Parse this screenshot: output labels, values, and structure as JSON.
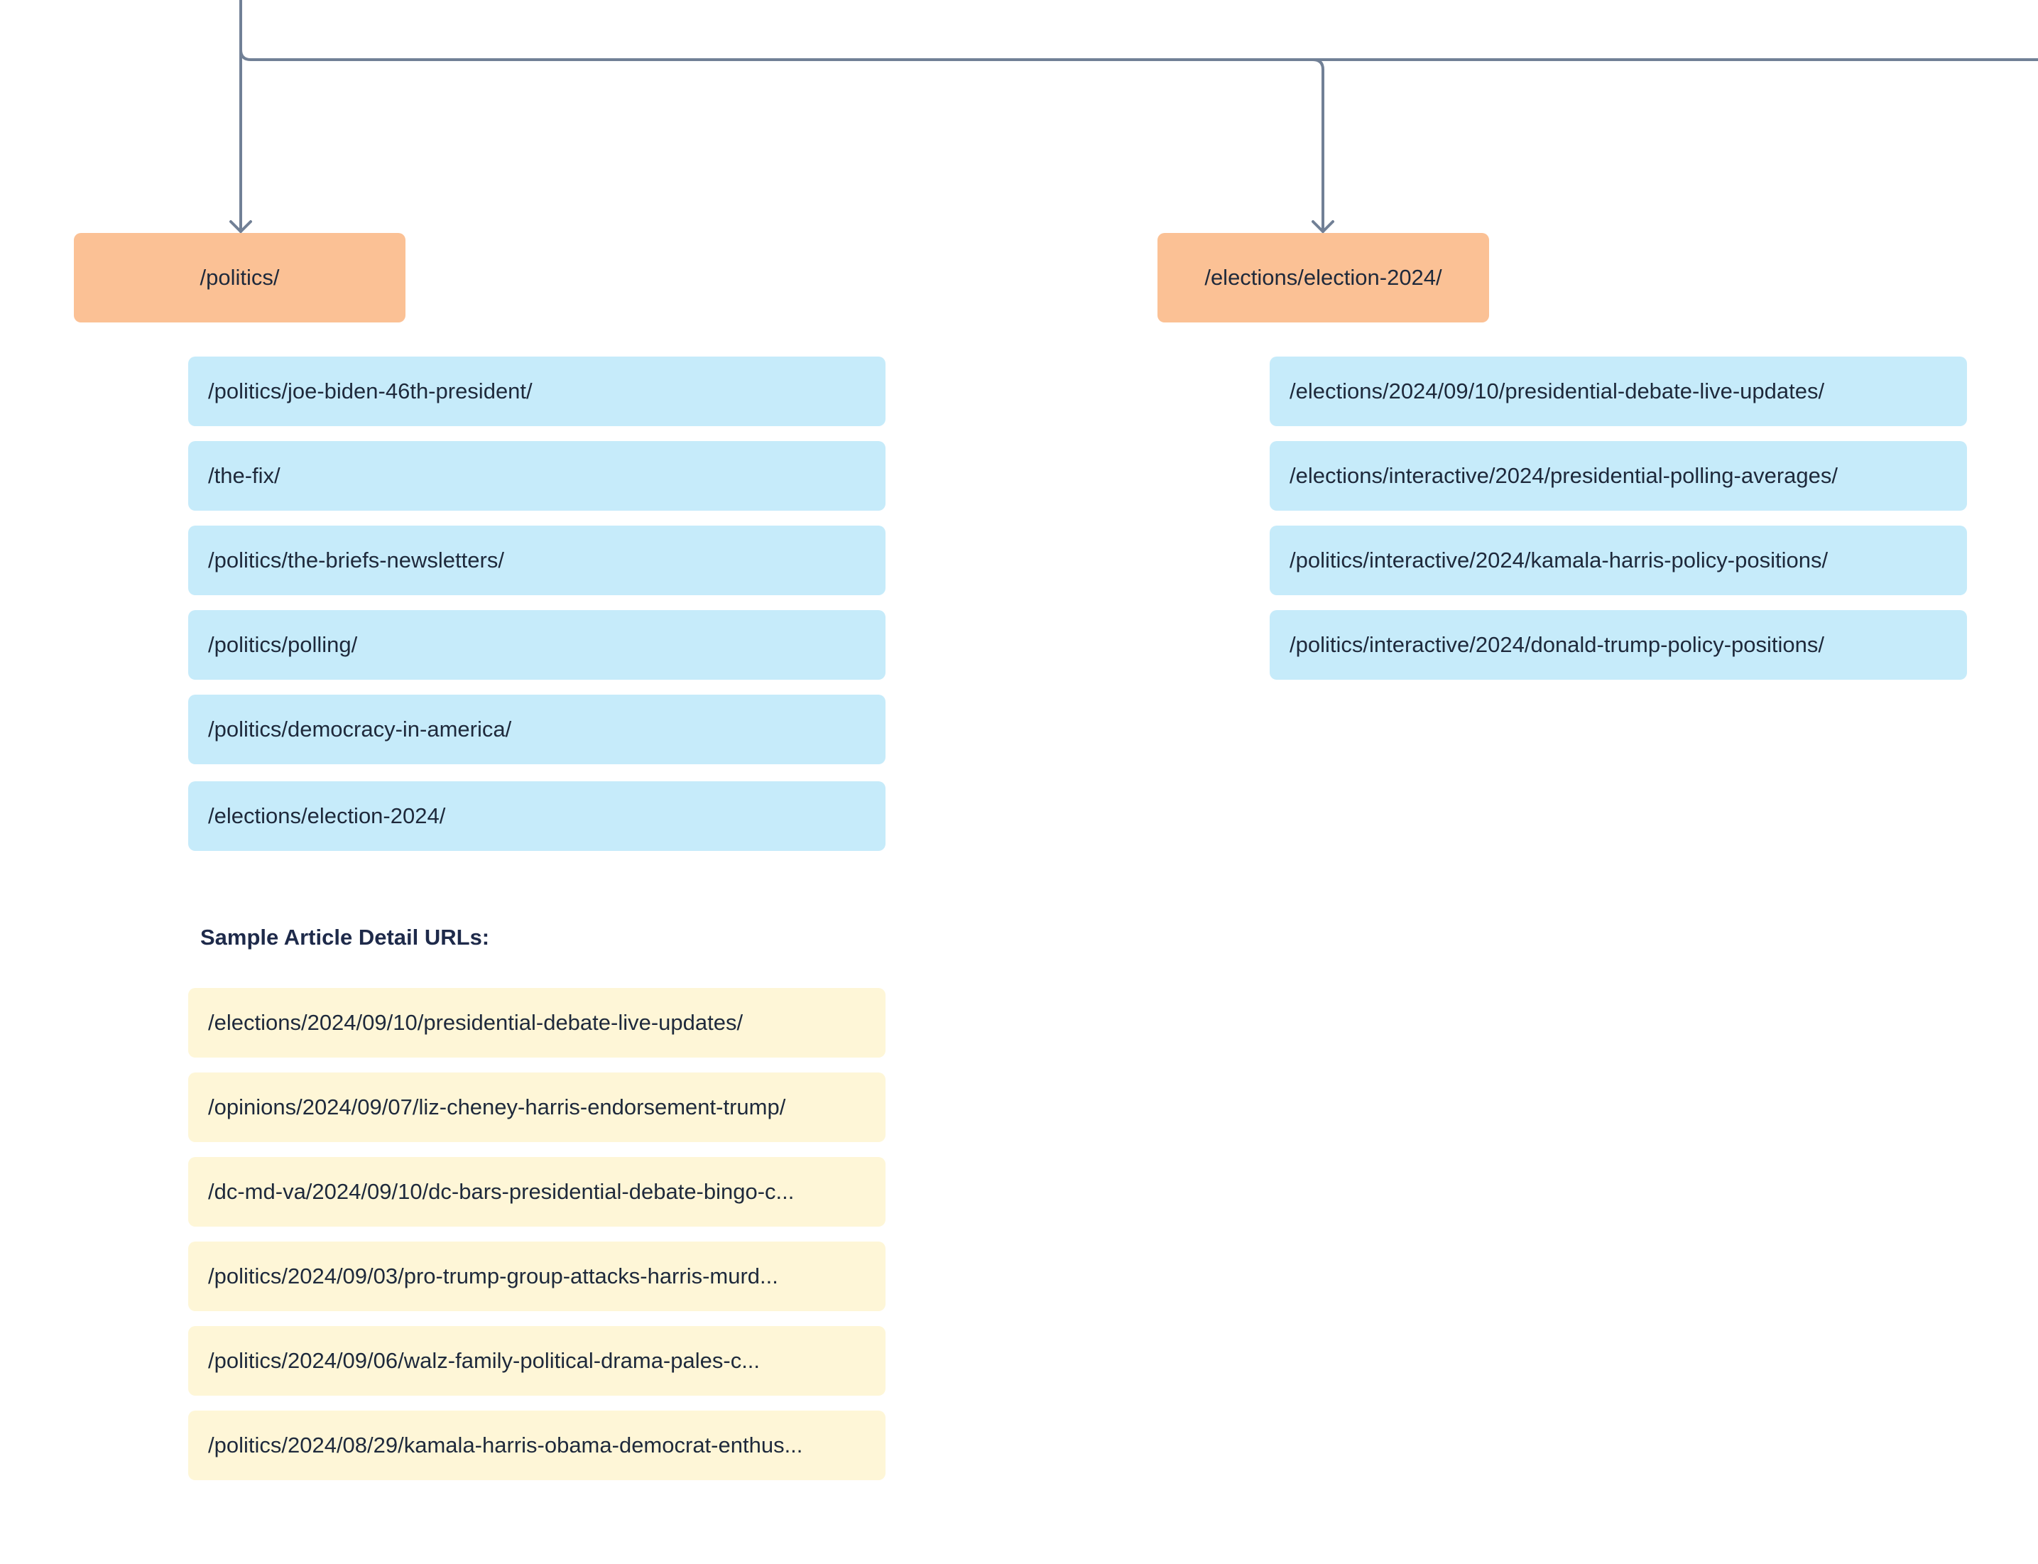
{
  "nodes": {
    "politics": {
      "label": "/politics/"
    },
    "elections": {
      "label": "/elections/election-2024/"
    }
  },
  "politics_children": [
    "/politics/joe-biden-46th-president/",
    "/the-fix/",
    "/politics/the-briefs-newsletters/",
    "/politics/polling/",
    "/politics/democracy-in-america/",
    "/elections/election-2024/"
  ],
  "elections_children": [
    "/elections/2024/09/10/presidential-debate-live-updates/",
    "/elections/interactive/2024/presidential-polling-averages/",
    "/politics/interactive/2024/kamala-harris-policy-positions/",
    "/politics/interactive/2024/donald-trump-policy-positions/"
  ],
  "sample_articles": {
    "heading": "Sample Article Detail URLs:",
    "items": [
      "/elections/2024/09/10/presidential-debate-live-updates/",
      "/opinions/2024/09/07/liz-cheney-harris-endorsement-trump/",
      "/dc-md-va/2024/09/10/dc-bars-presidential-debate-bingo-c...",
      "/politics/2024/09/03/pro-trump-group-attacks-harris-murd...",
      "/politics/2024/09/06/walz-family-political-drama-pales-c...",
      "/politics/2024/08/29/kamala-harris-obama-democrat-enthus..."
    ]
  },
  "colors": {
    "connector": "#718096",
    "section_node": "#fbc195",
    "child_item": "#c6ebfa",
    "article_item": "#fef6d7",
    "text": "#1e293b"
  }
}
